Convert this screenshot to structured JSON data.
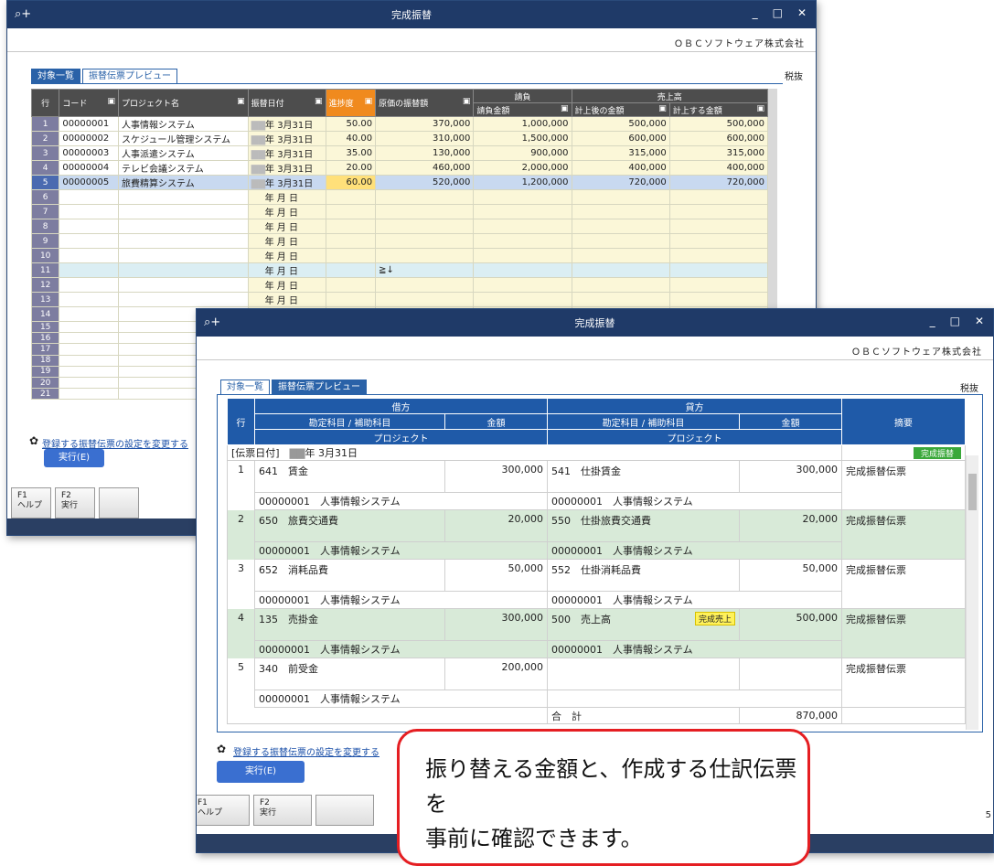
{
  "window_back": {
    "title": "完成振替",
    "company": "ＯＢＣソフトウェア株式会社",
    "tabs": [
      "対象一覧",
      "振替伝票プレビュー"
    ],
    "tax": "税抜",
    "headers": {
      "row": "行",
      "code": "コード",
      "project": "プロジェクト名",
      "date": "振替日付",
      "progress": "進捗度",
      "cost": "原価の振替額",
      "contract_group": "請負",
      "contract_amount": "請負金額",
      "sales_group": "売上高",
      "sales_after": "計上後の金額",
      "sales_amount": "計上する金額"
    },
    "rows": [
      {
        "n": "1",
        "code": "00000001",
        "name": "人事情報システム",
        "date": "年  3月31日",
        "progress": "50.00",
        "cost": "370,000",
        "contract": "1,000,000",
        "after": "500,000",
        "amount": "500,000"
      },
      {
        "n": "2",
        "code": "00000002",
        "name": "スケジュール管理システム",
        "date": "年  3月31日",
        "progress": "40.00",
        "cost": "310,000",
        "contract": "1,500,000",
        "after": "600,000",
        "amount": "600,000"
      },
      {
        "n": "3",
        "code": "00000003",
        "name": "人事派遣システム",
        "date": "年  3月31日",
        "progress": "35.00",
        "cost": "130,000",
        "contract": "900,000",
        "after": "315,000",
        "amount": "315,000"
      },
      {
        "n": "4",
        "code": "00000004",
        "name": "テレビ会議システム",
        "date": "年  3月31日",
        "progress": "20.00",
        "cost": "460,000",
        "contract": "2,000,000",
        "after": "400,000",
        "amount": "400,000"
      },
      {
        "n": "5",
        "code": "00000005",
        "name": "旅費精算システム",
        "date": "年  3月31日",
        "progress": "60.00",
        "cost": "520,000",
        "contract": "1,200,000",
        "after": "720,000",
        "amount": "720,000"
      }
    ],
    "empty_date": "年  月  日",
    "empty_rows": [
      "6",
      "7",
      "8",
      "9",
      "10",
      "11",
      "12",
      "13",
      "14",
      "15",
      "16",
      "17",
      "18",
      "19",
      "20",
      "21"
    ],
    "cursor_mark": "≧↓",
    "settings_link": "登録する振替伝票の設定を変更する",
    "exec_label": "実行(E)",
    "fkeys": [
      {
        "k": "F1",
        "l": "ヘルプ"
      },
      {
        "k": "F2",
        "l": "実行"
      }
    ]
  },
  "window_front": {
    "title": "完成振替",
    "company": "ＯＢＣソフトウェア株式会社",
    "tabs": [
      "対象一覧",
      "振替伝票プレビュー"
    ],
    "tax": "税抜",
    "headers": {
      "row": "行",
      "debit": "借方",
      "credit": "貸方",
      "account": "勘定科目 / 補助科目",
      "amount": "金額",
      "project": "プロジェクト",
      "memo": "摘要"
    },
    "voucher_date_label": "[伝票日付]",
    "voucher_date": "年  3月31日",
    "voucher_badge": "完成振替",
    "entries": [
      {
        "n": "1",
        "dcode": "641",
        "dname": "賃金",
        "damt": "300,000",
        "ccode": "541",
        "cname": "仕掛賃金",
        "cbadge": "",
        "camt": "300,000",
        "memo": "完成振替伝票",
        "dproj": "00000001　人事情報システム",
        "cproj": "00000001　人事情報システム"
      },
      {
        "n": "2",
        "dcode": "650",
        "dname": "旅費交通費",
        "damt": "20,000",
        "ccode": "550",
        "cname": "仕掛旅費交通費",
        "cbadge": "",
        "camt": "20,000",
        "memo": "完成振替伝票",
        "dproj": "00000001　人事情報システム",
        "cproj": "00000001　人事情報システム"
      },
      {
        "n": "3",
        "dcode": "652",
        "dname": "消耗品費",
        "damt": "50,000",
        "ccode": "552",
        "cname": "仕掛消耗品費",
        "cbadge": "",
        "camt": "50,000",
        "memo": "完成振替伝票",
        "dproj": "00000001　人事情報システム",
        "cproj": "00000001　人事情報システム"
      },
      {
        "n": "4",
        "dcode": "135",
        "dname": "売掛金",
        "damt": "300,000",
        "ccode": "500",
        "cname": "売上高",
        "cbadge": "完成売上",
        "camt": "500,000",
        "memo": "完成振替伝票",
        "dproj": "00000001　人事情報システム",
        "cproj": "00000001　人事情報システム"
      },
      {
        "n": "5",
        "dcode": "340",
        "dname": "前受金",
        "damt": "200,000",
        "ccode": "",
        "cname": "",
        "cbadge": "",
        "camt": "",
        "memo": "完成振替伝票",
        "dproj": "00000001　人事情報システム",
        "cproj": ""
      }
    ],
    "total_label": "合　計",
    "total": "870,000",
    "settings_link": "登録する振替伝票の設定を変更する",
    "exec_label": "実行(E)",
    "fkeys": [
      {
        "k": "F1",
        "l": "ヘルプ"
      },
      {
        "k": "F2",
        "l": "実行"
      }
    ],
    "page_num": "5"
  },
  "callout": {
    "line1": "振り替える金額と、作成する仕訳伝票を",
    "line2": "事前に確認できます。"
  }
}
